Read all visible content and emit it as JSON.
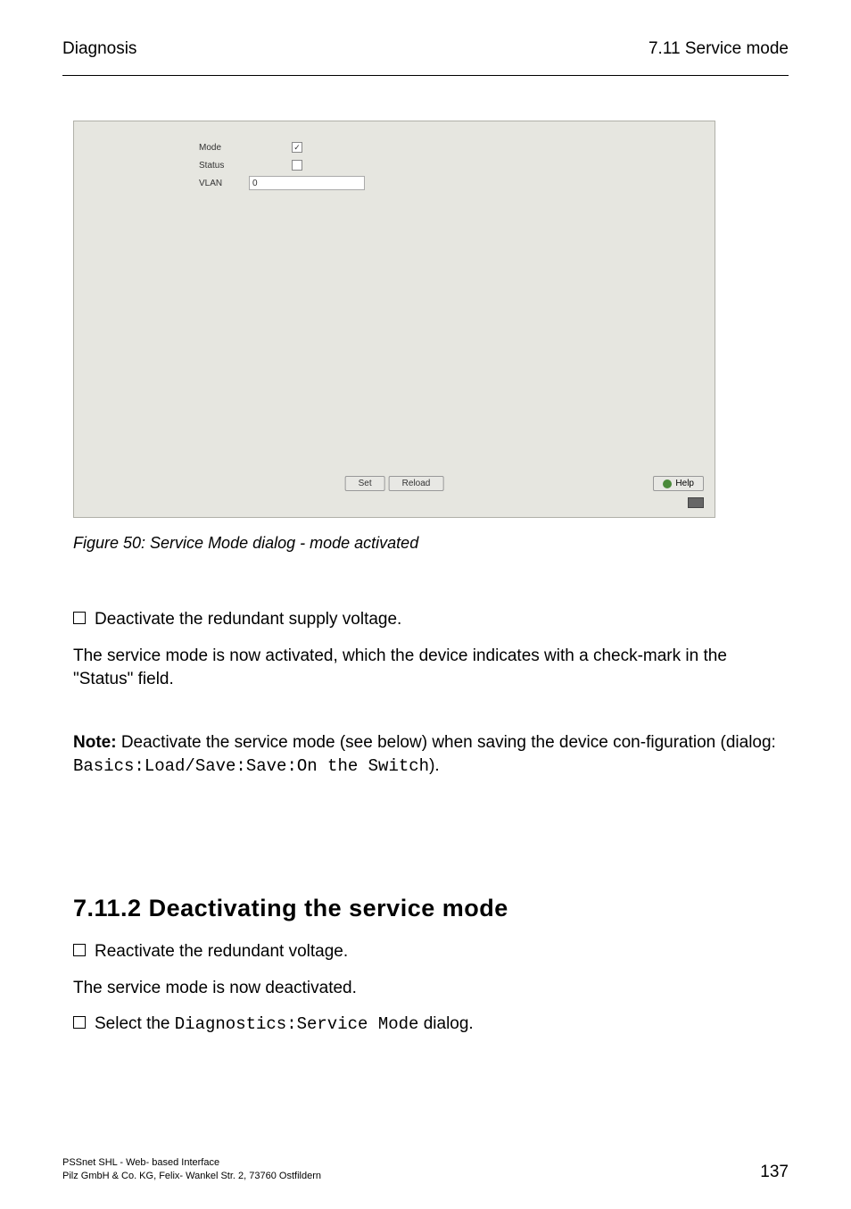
{
  "header": {
    "left": "Diagnosis",
    "right": "7.11 Service mode"
  },
  "dialog": {
    "mode_label": "Mode",
    "status_label": "Status",
    "vlan_label": "VLAN",
    "vlan_value": "0",
    "mode_checked": "✓",
    "set_label": "Set",
    "reload_label": "Reload",
    "help_label": "Help"
  },
  "figure_caption": "Figure 50: Service Mode dialog - mode activated",
  "step_deactivate": "Deactivate the redundant supply voltage.",
  "paragraph_activated": "The service mode is now activated, which the device indicates with a check-mark in the \"Status\" field.",
  "note": {
    "prefix": "Note: ",
    "text_before_code": "Deactivate the service mode (see below) when saving the device con-figuration (dialog: ",
    "code": "Basics:Load/Save:Save:On the Switch",
    "text_after_code": ")."
  },
  "section_heading": "7.11.2 Deactivating the service mode",
  "step_reactivate": "Reactivate the redundant voltage.",
  "paragraph_deactivated": "The service mode is now deactivated.",
  "step_select_prefix": "Select the ",
  "step_select_code": "Diagnostics:Service Mode",
  "step_select_suffix": " dialog.",
  "footer": {
    "line1": "PSSnet SHL - Web- based Interface",
    "line2": "Pilz GmbH & Co. KG, Felix- Wankel Str. 2, 73760 Ostfildern",
    "page": "137"
  }
}
